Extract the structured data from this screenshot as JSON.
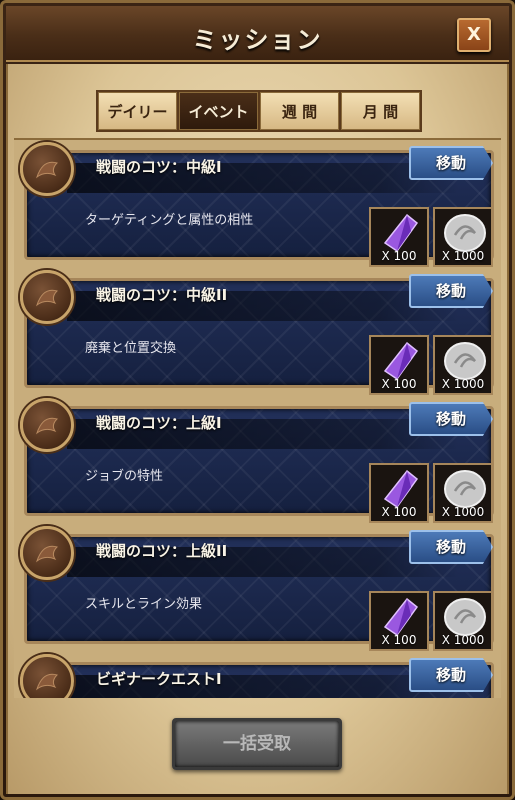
{
  "header": {
    "title": "ミッション",
    "close_label": "X"
  },
  "tabs": [
    {
      "label": "デイリー",
      "active": false
    },
    {
      "label": "イベント",
      "active": true
    },
    {
      "label": "週 間",
      "active": false
    },
    {
      "label": "月 間",
      "active": false
    }
  ],
  "missions": [
    {
      "title": "戦闘のコツ：中級I",
      "description": "ターゲティングと属性の相性",
      "button": "移動",
      "reward_crystal": "X 100",
      "reward_coin": "X 1000"
    },
    {
      "title": "戦闘のコツ：中級II",
      "description": "廃棄と位置交換",
      "button": "移動",
      "reward_crystal": "X 100",
      "reward_coin": "X 1000"
    },
    {
      "title": "戦闘のコツ：上級I",
      "description": "ジョブの特性",
      "button": "移動",
      "reward_crystal": "X 100",
      "reward_coin": "X 1000"
    },
    {
      "title": "戦闘のコツ：上級II",
      "description": "スキルとライン効果",
      "button": "移動",
      "reward_crystal": "X 100",
      "reward_coin": "X 1000"
    },
    {
      "title": "ビギナークエストI",
      "button": "移動"
    }
  ],
  "footer": {
    "claim_all_label": "一括受取"
  },
  "colors": {
    "card_bg": "#1b2a52",
    "move_button": "#3a64a4",
    "parchment": "#e6d2a8",
    "active_tab": "#3a2210"
  },
  "icons": {
    "emblem": "leaf-emblem-icon",
    "crystal": "purple-crystal-icon",
    "coin": "silver-coin-icon"
  }
}
